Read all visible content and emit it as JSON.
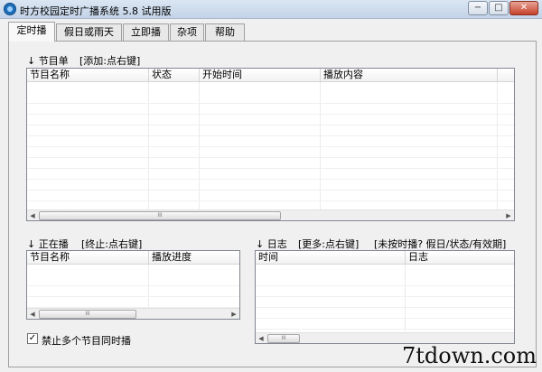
{
  "window": {
    "title": "时方校园定时广播系统 5.8 试用版",
    "buttons": {
      "minimize": "−",
      "maximize": "□",
      "close": "✕"
    }
  },
  "tabs": [
    {
      "label": "定时播",
      "active": true
    },
    {
      "label": "假日或雨天",
      "active": false
    },
    {
      "label": "立即播",
      "active": false
    },
    {
      "label": "杂项",
      "active": false
    },
    {
      "label": "帮助",
      "active": false
    }
  ],
  "program_list": {
    "section_label": "↓ 节目单",
    "hint": "[添加:点右键]",
    "columns": [
      "节目名称",
      "状态",
      "开始时间",
      "播放内容"
    ]
  },
  "now_playing": {
    "section_label": "↓ 正在播",
    "hint": "[终止:点右键]",
    "columns": [
      "节目名称",
      "播放进度"
    ]
  },
  "log": {
    "section_label": "↓ 日志",
    "hint": "[更多:点右键]",
    "status_hint": "[未按时播? 假日/状态/有效期]",
    "columns": [
      "时间",
      "日志"
    ]
  },
  "options": {
    "no_simultaneous_label": "禁止多个节目同时播",
    "no_simultaneous_checked": true
  },
  "scroll": {
    "left_arrow": "◀",
    "right_arrow": "▶",
    "grip": "III"
  },
  "watermark": "7tdown.com"
}
